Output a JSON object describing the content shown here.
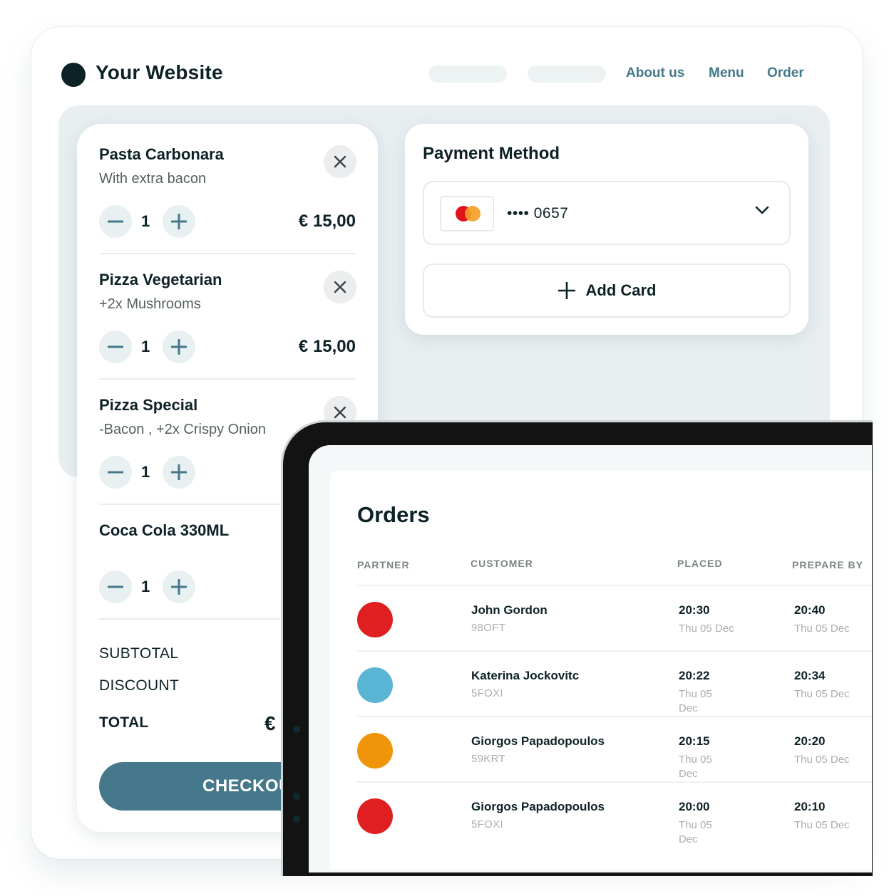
{
  "site": {
    "title": "Your Website",
    "nav": [
      {
        "label": "About us"
      },
      {
        "label": "Menu"
      },
      {
        "label": "Order"
      }
    ]
  },
  "cart": {
    "items": [
      {
        "name": "Pasta Carbonara",
        "description": "With extra bacon",
        "quantity": "1",
        "price": "€ 15,00"
      },
      {
        "name": "Pizza Vegetarian",
        "description": "+2x Mushrooms",
        "quantity": "1",
        "price": "€ 15,00"
      },
      {
        "name": "Pizza Special",
        "description": "-Bacon , +2x Crispy Onion",
        "quantity": "1",
        "price": ""
      },
      {
        "name": "Coca Cola 330ML",
        "description": "",
        "quantity": "1",
        "price": ""
      }
    ],
    "summary": {
      "subtotal_label": "SUBTOTAL",
      "discount_label": "DISCOUNT",
      "total_label": "TOTAL",
      "total_value_visible": "€"
    },
    "checkout_label": "CHECKOUT"
  },
  "payment": {
    "title": "Payment Method",
    "selected_card": {
      "brand_icon": "mastercard-icon",
      "masked_number": "•••• 0657"
    },
    "add_card_label": "Add Card"
  },
  "orders": {
    "title": "Orders",
    "columns": [
      "PARTNER",
      "CUSTOMER",
      "PLACED",
      "PREPARE BY"
    ],
    "rows": [
      {
        "partner_color": "#e02020",
        "customer": "John Gordon",
        "code": "98OFT",
        "placed_time": "20:30",
        "placed_date": "Thu 05 Dec",
        "prepare_time": "20:40",
        "prepare_date": "Thu 05 Dec"
      },
      {
        "partner_color": "#5ab4d4",
        "customer": "Katerina Jockovitc",
        "code": "5FOXI",
        "placed_time": "20:22",
        "placed_date": "Thu 05 Dec",
        "prepare_time": "20:34",
        "prepare_date": "Thu 05 Dec"
      },
      {
        "partner_color": "#f0950a",
        "customer": "Giorgos Papadopoulos",
        "code": "59KRT",
        "placed_time": "20:15",
        "placed_date": "Thu 05 Dec",
        "prepare_time": "20:20",
        "prepare_date": "Thu 05 Dec"
      },
      {
        "partner_color": "#e02020",
        "customer": "Giorgos Papadopoulos",
        "code": "5FOXI",
        "placed_time": "20:00",
        "placed_date": "Thu 05 Dec",
        "prepare_time": "20:10",
        "prepare_date": "Thu 05 Dec"
      }
    ]
  },
  "colors": {
    "brand_dark": "#0d2226",
    "accent": "#45788a",
    "panel_bg": "#e9eff1"
  }
}
